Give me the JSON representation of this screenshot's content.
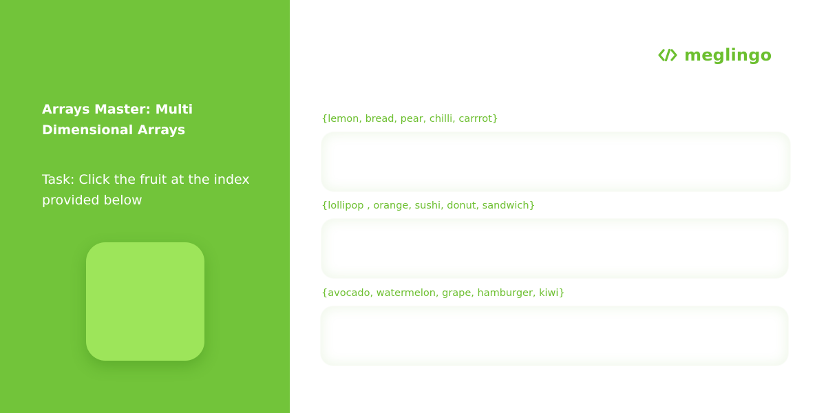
{
  "lesson": {
    "title": "Arrays Master: Multi Dimensional Arrays",
    "task": "Task: Click the fruit at the index provided below"
  },
  "brand": {
    "name": "meglingo",
    "icon": "code-brackets-icon",
    "color": "#6cbf2f"
  },
  "colors": {
    "panel_green": "#72c43a",
    "index_box": "#9de55a",
    "accent_text": "#6cbf2f"
  },
  "arrays": [
    {
      "label": "{lemon, bread, pear, chilli, carrrot}"
    },
    {
      "label": "{lollipop , orange, sushi, donut, sandwich}"
    },
    {
      "label": "{avocado, watermelon, grape, hamburger, kiwi}"
    }
  ]
}
